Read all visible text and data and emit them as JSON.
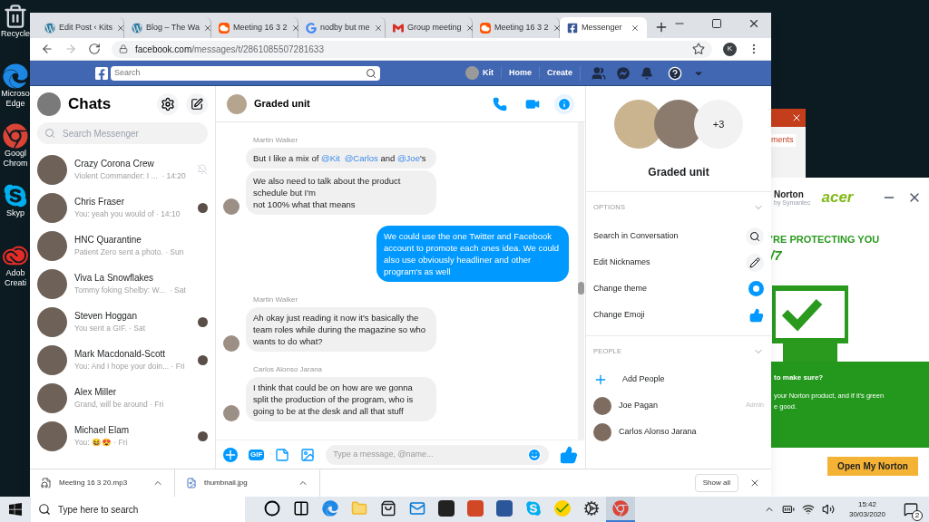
{
  "desktop": {
    "icons": [
      {
        "kind": "recycle",
        "lines": [
          "Recycle"
        ]
      },
      {
        "kind": "edge",
        "lines": [
          "Microso",
          "Edge"
        ]
      },
      {
        "kind": "chrome",
        "lines": [
          "Googl",
          "Chrom"
        ]
      },
      {
        "kind": "skype",
        "lines": [
          "Skyp"
        ]
      },
      {
        "kind": "adobe",
        "lines": [
          "Adob",
          "Creati"
        ]
      }
    ]
  },
  "background_window": {
    "label": "ments"
  },
  "browser": {
    "tabs": [
      {
        "kind": "wordpress",
        "title": "Edit Post ‹ Kits",
        "selected": false
      },
      {
        "kind": "wordpress",
        "title": "Blog – The Wa",
        "selected": false
      },
      {
        "kind": "soundcloud",
        "title": "Meeting 16 3 2",
        "selected": false
      },
      {
        "kind": "google",
        "title": "nodby but me",
        "selected": false
      },
      {
        "kind": "gmail",
        "title": "Group meeting",
        "selected": false
      },
      {
        "kind": "soundcloud",
        "title": "Meeting 16 3 2",
        "selected": false
      },
      {
        "kind": "facebook",
        "title": "Messenger",
        "selected": true
      }
    ],
    "address": {
      "host": "facebook.com",
      "path": "/messages/t/2861085507281633"
    },
    "profile_initial": "K"
  },
  "facebook_bar": {
    "search_placeholder": "Search",
    "user": "Kit",
    "links": [
      "Home",
      "Create"
    ]
  },
  "chats": {
    "title": "Chats",
    "search_placeholder": "Search Messenger",
    "items": [
      {
        "kind": "muted",
        "name": "Crazy Corona Crew",
        "preview": "Violent Commander: I ...  · 14:20"
      },
      {
        "kind": "seen",
        "name": "Chris Fraser",
        "preview": "You: yeah you would of · 14:10"
      },
      {
        "kind": "plain",
        "name": "HNC Quarantine",
        "preview": "Patient Zero sent a photo. · Sun"
      },
      {
        "kind": "plain",
        "name": "Viva La Snowflakes",
        "preview": "Tommy foking Shelby: W...  · Sat"
      },
      {
        "kind": "seen",
        "name": "Steven Hoggan",
        "preview": "You sent a GIF. · Sat"
      },
      {
        "kind": "seen",
        "name": "Mark Macdonald-Scott",
        "preview": "You: And I hope your doin... · Fri"
      },
      {
        "kind": "plain",
        "name": "Alex Miller",
        "preview": "Grand, will be around · Fri"
      },
      {
        "kind": "seen",
        "name": "Michael Elam",
        "preview": "You: 😆😍 · Fri"
      }
    ]
  },
  "conversation": {
    "title": "Graded unit",
    "messages": [
      {
        "kind": "sender",
        "text": "Martin Walker"
      },
      {
        "kind": "incoming",
        "avatar": false,
        "segments": [
          {
            "kind": "text",
            "text": "But I like a mix of "
          },
          {
            "kind": "mention",
            "text": "@Kit"
          },
          {
            "kind": "mention",
            "text": "@Carlos"
          },
          {
            "kind": "text",
            "text": " and "
          },
          {
            "kind": "mention",
            "text": "@Joe"
          },
          {
            "kind": "text",
            "text": "'s"
          }
        ]
      },
      {
        "kind": "incoming",
        "avatar": true,
        "segments": [
          {
            "kind": "text",
            "text": "We also need to talk about the product schedule but I'm\nnot 100% what that means"
          }
        ]
      },
      {
        "kind": "outgoing",
        "segments": [
          {
            "kind": "text",
            "text": "We could use the one Twitter and Facebook account to promote each ones idea. We could also use obviously headliner and other program's as well"
          }
        ]
      },
      {
        "kind": "sender",
        "text": "Martin Walker"
      },
      {
        "kind": "incoming",
        "avatar": true,
        "segments": [
          {
            "kind": "text",
            "text": "Ah okay just reading it now it's basically the team roles while during the magazine so who wants to do what?"
          }
        ]
      },
      {
        "kind": "sender",
        "text": "Carlos Alonso Jarana"
      },
      {
        "kind": "incoming",
        "avatar": true,
        "segments": [
          {
            "kind": "text",
            "text": "I think that could be on how are we gonna split the production of the program, who is going to be at the desk and all that stuff"
          }
        ]
      }
    ],
    "gif_label": "GIF",
    "composer_placeholder": "Type a message, @name..."
  },
  "details": {
    "more_count": "+3",
    "title": "Graded unit",
    "options_heading": "OPTIONS",
    "options": [
      {
        "kind": "search",
        "label": "Search in Conversation"
      },
      {
        "kind": "nickname",
        "label": "Edit Nicknames"
      },
      {
        "kind": "theme",
        "label": "Change theme"
      },
      {
        "kind": "emoji",
        "label": "Change Emoji"
      }
    ],
    "people_heading": "PEOPLE",
    "add_people": "Add People",
    "people": [
      {
        "name": "Joe Pagan",
        "role": "Admin"
      },
      {
        "name": "Carlos Alonso Jarana"
      }
    ]
  },
  "downloads": {
    "files": [
      {
        "kind": "audio",
        "name": "Meeting 16 3 20.mp3"
      },
      {
        "kind": "image",
        "name": "thumbnail.jpg"
      }
    ],
    "show_all": "Show all"
  },
  "norton": {
    "brand": "Norton",
    "brand_sub": "by Symantec",
    "partner": "acer",
    "headline": "’RE PROTECTING YOU",
    "headline_2": "/7",
    "question": "to make sure?",
    "body": "your Norton product, and if it's green",
    "body_2": "e good.",
    "button": "Open My Norton"
  },
  "taskbar": {
    "search_placeholder": "Type here to search",
    "apps": [
      {
        "kind": "cortana",
        "selected": false
      },
      {
        "kind": "taskview",
        "selected": false
      },
      {
        "kind": "edge",
        "selected": false
      },
      {
        "kind": "explorer",
        "selected": false
      },
      {
        "kind": "store",
        "selected": false
      },
      {
        "kind": "mail",
        "selected": false
      },
      {
        "kind": "notion",
        "selected": false
      },
      {
        "kind": "powerpoint",
        "selected": false
      },
      {
        "kind": "word",
        "selected": false
      },
      {
        "kind": "skype",
        "selected": false
      },
      {
        "kind": "norton",
        "selected": false
      },
      {
        "kind": "settings",
        "selected": false
      },
      {
        "kind": "chrome",
        "selected": true
      }
    ],
    "time": "15:42",
    "date": "30/03/2020",
    "notifications": "2"
  }
}
